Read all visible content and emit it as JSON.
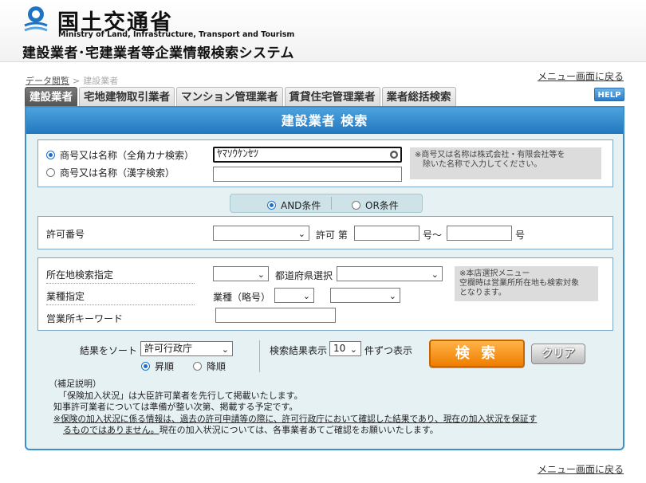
{
  "header": {
    "ministry_name": "国土交通省",
    "ministry_name_en": "Ministry of Land, Infrastructure, Transport and Tourism",
    "system_title": "建設業者･宅建業者等企業情報検索システム"
  },
  "breadcrumb": {
    "parent": "データ閲覧",
    "separator": ">",
    "current": "建設業者"
  },
  "menu_link": "メニュー画面に戻る",
  "tabs": [
    {
      "label": "建設業者",
      "active": true
    },
    {
      "label": "宅地建物取引業者",
      "active": false
    },
    {
      "label": "マンション管理業者",
      "active": false
    },
    {
      "label": "賃貸住宅管理業者",
      "active": false
    },
    {
      "label": "業者総括検索",
      "active": false
    }
  ],
  "help_label": "HELP",
  "panel_title": "建設業者 検索",
  "name_search": {
    "option_kana": "商号又は名称（全角カナ検索）",
    "option_kanji": "商号又は名称（漢字検索）",
    "kana_value": "ﾔﾏｿｳｹﾝｾﾂ",
    "kanji_value": "",
    "note": "※商号又は名称は株式会社・有限会社等を除いた名称で入力してください。",
    "note_line1": "※商号又は名称は株式会社・有限会社等を",
    "note_line2": "除いた名称で入力してください。",
    "selected": "kana"
  },
  "conditions": {
    "and_label": "AND条件",
    "or_label": "OR条件",
    "selected": "and"
  },
  "license": {
    "label": "許可番号",
    "prefix": "許可 第",
    "middle": "号～",
    "suffix": "号",
    "select_value": "",
    "from_value": "",
    "to_value": ""
  },
  "location": {
    "location_label": "所在地検索指定",
    "prefecture_label": "都道府県選択",
    "industry_label": "業種指定",
    "industry_abbr_label": "業種（略号）",
    "keyword_label": "営業所キーワード",
    "note_line1": "※本店選択メニュー",
    "note_line2": "空欄時は営業所所在地も検索対象",
    "note_line3": "となります。"
  },
  "sort": {
    "label": "結果をソート",
    "value": "許可行政庁",
    "asc_label": "昇順",
    "desc_label": "降順",
    "order": "asc"
  },
  "display": {
    "label": "検索結果表示",
    "count": "10",
    "suffix": "件ずつ表示"
  },
  "buttons": {
    "search": "検 索",
    "clear": "クリア"
  },
  "notes": {
    "heading": "（補足説明）",
    "line1": "「保険加入状況」は大臣許可業者を先行して掲載いたします。",
    "line2": "知事許可業者については準備が整い次第、掲載する予定です。",
    "line3": "※保険の加入状況に係る情報は、過去の許可申請等の際に、許可行政庁において確認した結果であり、現在の加入状況を保証す",
    "line4a": "るものではありません。",
    "line4b": "現在の加入状況については、各事業者あてご確認をお願いいたします。"
  },
  "colors": {
    "accent": "#2277bf",
    "search_button": "#ef7e00",
    "active_tab": "#555555"
  }
}
